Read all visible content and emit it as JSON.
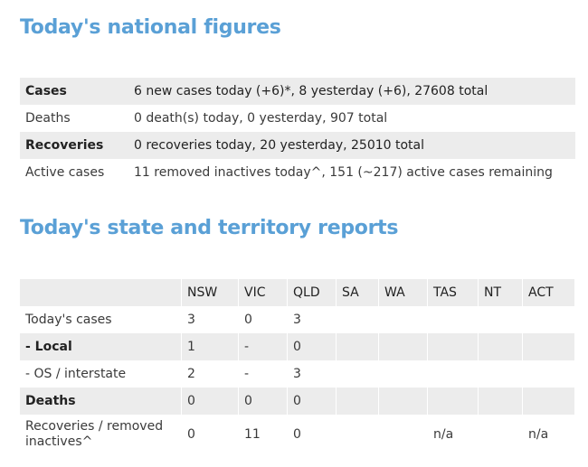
{
  "national": {
    "heading": "Today's national figures",
    "rows": [
      {
        "label": "Cases",
        "value": "6 new cases today (+6)*, 8 yesterday (+6), 27608 total"
      },
      {
        "label": "Deaths",
        "value": "0 death(s) today, 0 yesterday, 907 total"
      },
      {
        "label": "Recoveries",
        "value": "0 recoveries today, 20 yesterday, 25010 total"
      },
      {
        "label": "Active cases",
        "value": "11 removed inactives today^, 151 (~217) active cases remaining"
      }
    ]
  },
  "states": {
    "heading": "Today's state and territory reports",
    "columns": [
      "NSW",
      "VIC",
      "QLD",
      "SA",
      "WA",
      "TAS",
      "NT",
      "ACT"
    ],
    "rows": [
      {
        "label": "Today's cases",
        "cells": [
          "3",
          "0",
          "3",
          "",
          "",
          "",
          "",
          ""
        ]
      },
      {
        "label": "- Local",
        "cells": [
          "1",
          "-",
          "0",
          "",
          "",
          "",
          "",
          ""
        ]
      },
      {
        "label": "- OS / interstate",
        "cells": [
          "2",
          "-",
          "3",
          "",
          "",
          "",
          "",
          ""
        ]
      },
      {
        "label": "Deaths",
        "cells": [
          "0",
          "0",
          "0",
          "",
          "",
          "",
          "",
          ""
        ]
      },
      {
        "label": "Recoveries / removed inactives^",
        "cells": [
          "0",
          "11",
          "0",
          "",
          "",
          "n/a",
          "",
          "n/a"
        ]
      }
    ]
  }
}
